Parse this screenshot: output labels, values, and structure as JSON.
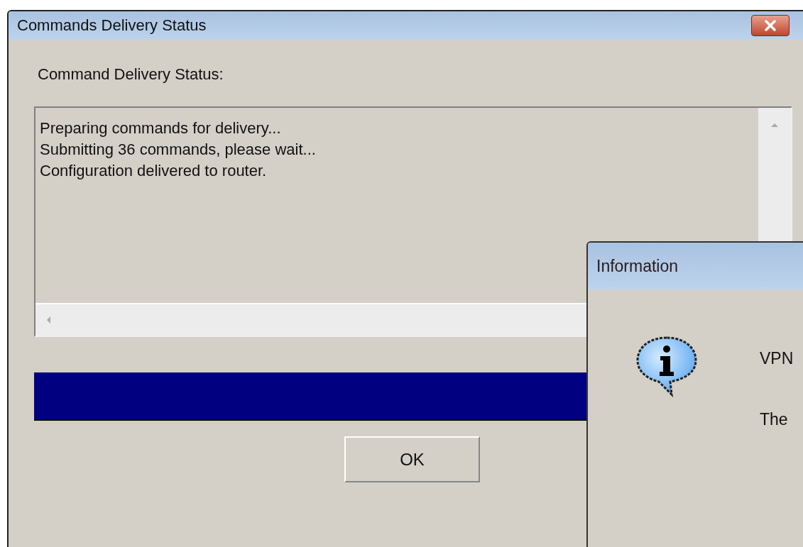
{
  "window": {
    "title": "Commands Delivery Status"
  },
  "status_label": "Command Delivery Status:",
  "log_lines": [
    "Preparing commands for delivery...",
    "Submitting 36 commands, please wait...",
    "Configuration delivered to router."
  ],
  "progress": {
    "level": 1
  },
  "buttons": [
    "OK"
  ],
  "dialog": {
    "title": "Information",
    "lines": [
      "VPN",
      "The"
    ]
  }
}
